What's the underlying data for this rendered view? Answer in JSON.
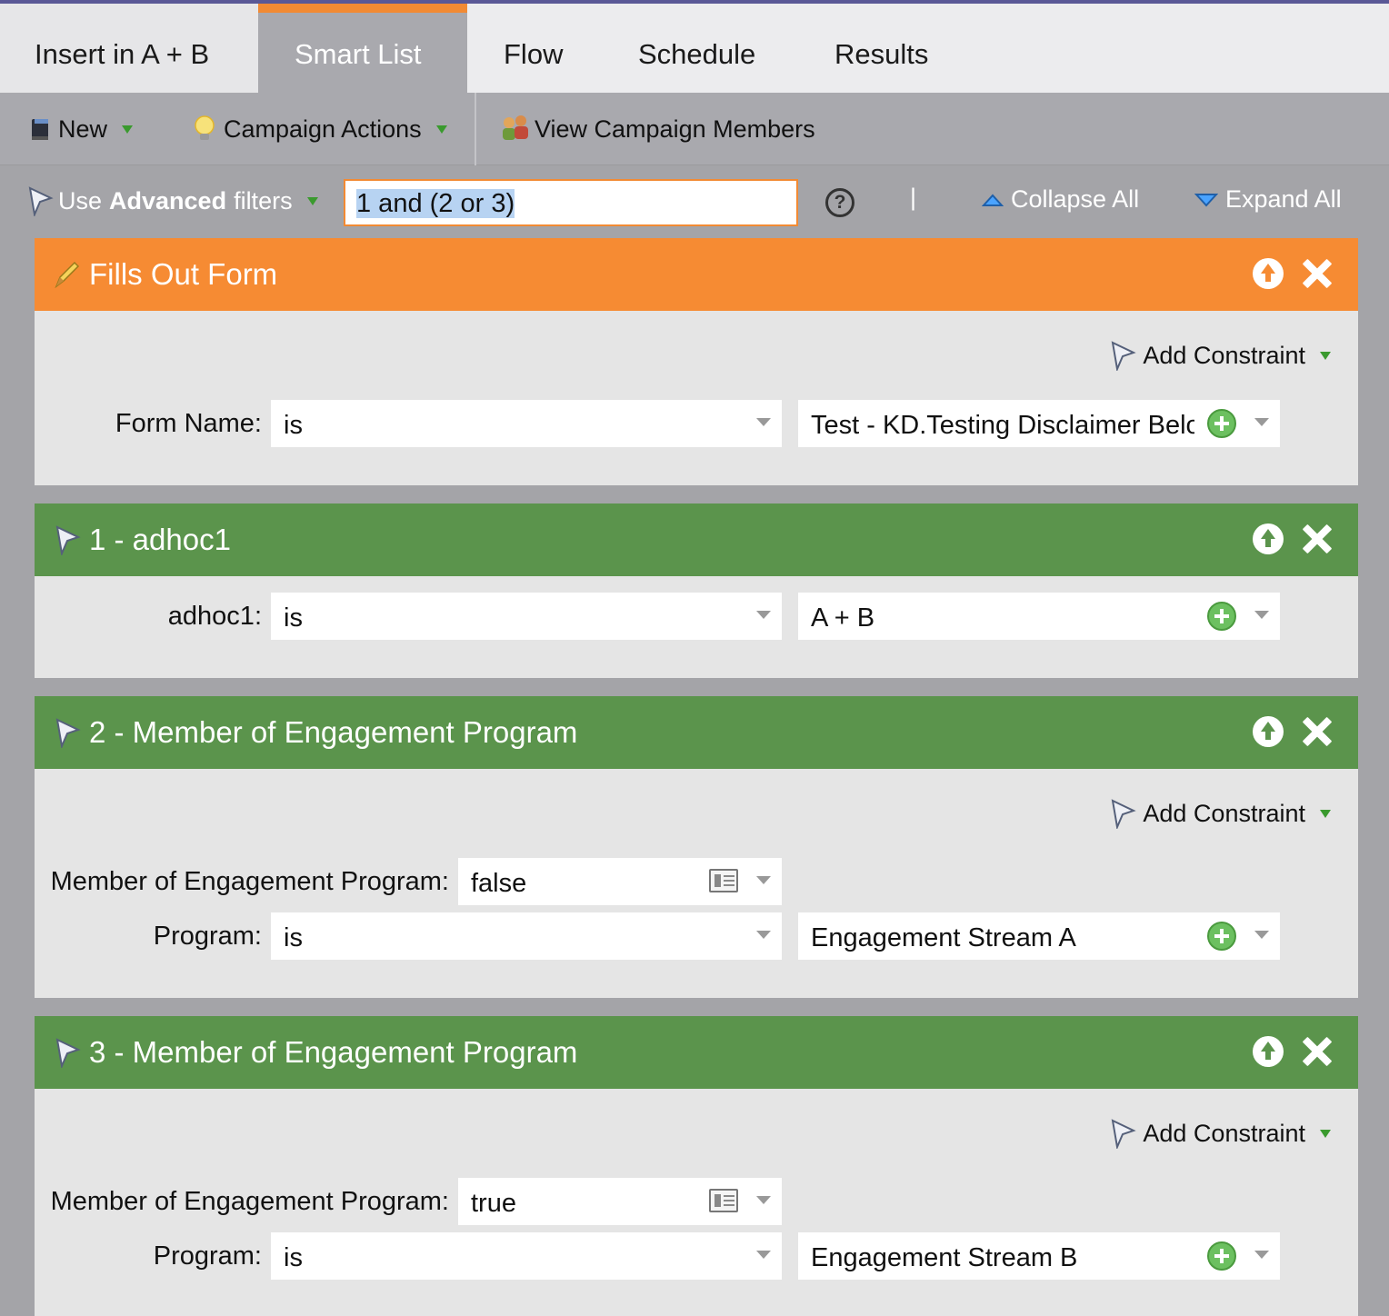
{
  "tabs": [
    {
      "label": "Insert in A + B"
    },
    {
      "label": "Smart List"
    },
    {
      "label": "Flow"
    },
    {
      "label": "Schedule"
    },
    {
      "label": "Results"
    }
  ],
  "toolbar": {
    "new_label": "New",
    "campaign_actions_label": "Campaign Actions",
    "view_members_label": "View Campaign Members"
  },
  "filterbar": {
    "use_label": "Use",
    "advanced_label": "Advanced",
    "filters_label": "filters",
    "logic_value": "1 and (2 or 3)",
    "help_glyph": "?",
    "divider": "|",
    "collapse_label": "Collapse All",
    "expand_label": "Expand All"
  },
  "filters": [
    {
      "title": "Fills Out Form",
      "color": "#f68b33",
      "add_constraint": "Add Constraint",
      "rows": [
        {
          "label": "Form Name:",
          "operator": "is",
          "value": "Test - KD.Testing Disclaimer Below"
        }
      ]
    },
    {
      "title": "1 - adhoc1",
      "color": "#5b944c",
      "rows": [
        {
          "label": "adhoc1:",
          "operator": "is",
          "value": "A + B"
        }
      ]
    },
    {
      "title": "2 - Member of Engagement Program",
      "color": "#5b944c",
      "add_constraint": "Add Constraint",
      "rows": [
        {
          "label": "Member of Engagement Program:",
          "value": "false"
        },
        {
          "label": "Program:",
          "operator": "is",
          "value": "Engagement Stream A"
        }
      ]
    },
    {
      "title": "3 - Member of Engagement Program",
      "color": "#5b944c",
      "add_constraint": "Add Constraint",
      "rows": [
        {
          "label": "Member of Engagement Program:",
          "value": "true"
        },
        {
          "label": "Program:",
          "operator": "is",
          "value": "Engagement Stream B"
        }
      ]
    }
  ],
  "icons": {
    "new": "book-icon",
    "campaign_actions": "lightbulb-icon",
    "view_members": "people-icon",
    "filter": "funnel-icon",
    "form": "pencil-icon",
    "move_up": "arrow-up-circle-icon",
    "remove": "close-icon",
    "add_value": "plus-circle-icon"
  },
  "colors": {
    "accent": "#f28a33",
    "filter_green": "#5b944c",
    "header_purple": "#5a5896"
  }
}
